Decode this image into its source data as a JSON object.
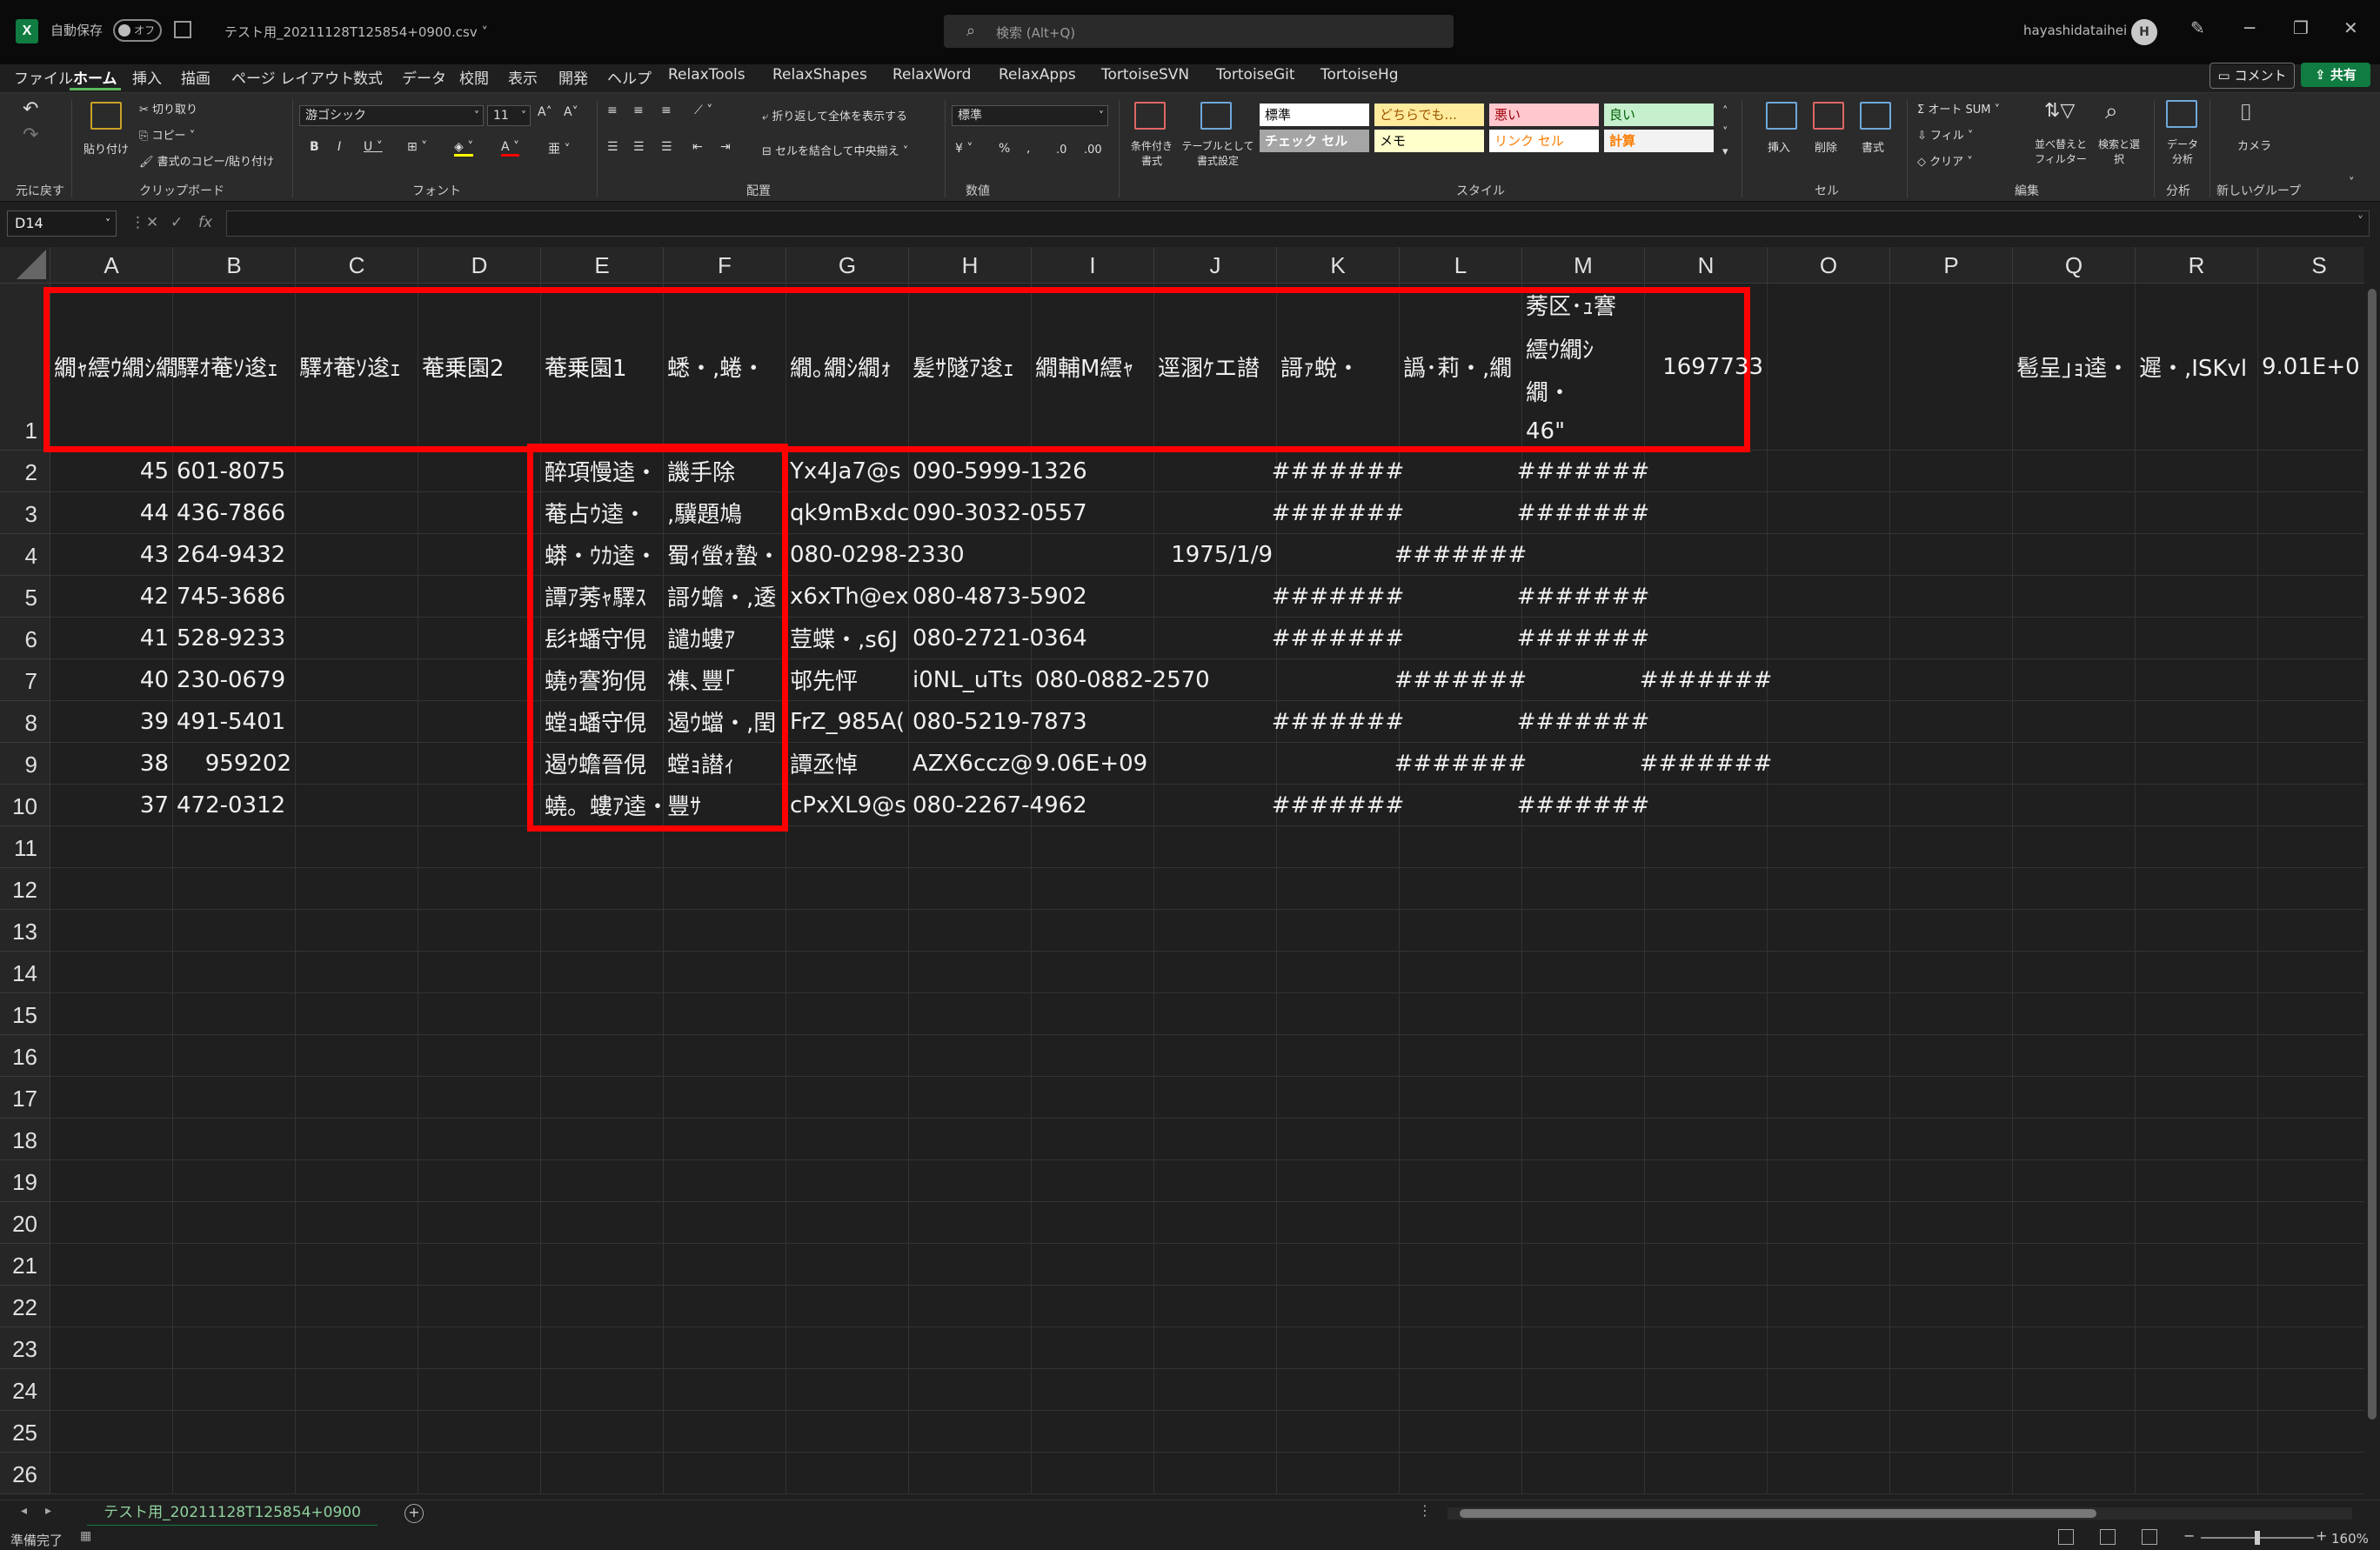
{
  "titlebar": {
    "autosave_label": "自動保存",
    "autosave_state": "オフ",
    "filename": "テスト用_20211128T125854+0900.csv ˅",
    "search_placeholder": "検索 (Alt+Q)",
    "user_name": "hayashidataihei",
    "avatar_initial": "H"
  },
  "tabs": [
    "ファイル",
    "ホーム",
    "挿入",
    "描画",
    "ページ レイアウト",
    "数式",
    "データ",
    "校閲",
    "表示",
    "開発",
    "ヘルプ",
    "RelaxTools",
    "RelaxShapes",
    "RelaxWord",
    "RelaxApps",
    "TortoiseSVN",
    "TortoiseGit",
    "TortoiseHg"
  ],
  "active_tab": "ホーム",
  "comment_button": "コメント",
  "share_button": "共有",
  "ribbon": {
    "undo_label": "元に戻す",
    "clipboard": {
      "paste": "貼り付け",
      "cut": "切り取り",
      "copy": "コピー",
      "format_painter": "書式のコピー/貼り付け",
      "label": "クリップボード"
    },
    "font": {
      "name": "游ゴシック",
      "size": "11",
      "label": "フォント"
    },
    "alignment": {
      "wrap": "折り返して全体を表示する",
      "merge": "セルを結合して中央揃え",
      "label": "配置"
    },
    "number": {
      "format": "標準",
      "label": "数値"
    },
    "styles": {
      "conditional": "条件付き書式",
      "table": "テーブルとして書式設定",
      "label": "スタイル",
      "cells": [
        {
          "text": "標準",
          "bg": "#ffffff",
          "fg": "#000000"
        },
        {
          "text": "どちらでも...",
          "bg": "#ffeb9c",
          "fg": "#9c5700"
        },
        {
          "text": "悪い",
          "bg": "#ffc7ce",
          "fg": "#9c0006"
        },
        {
          "text": "良い",
          "bg": "#c6efce",
          "fg": "#006100"
        },
        {
          "text": "チェック セル",
          "bg": "#a5a5a5",
          "fg": "#ffffff"
        },
        {
          "text": "メモ",
          "bg": "#ffffcc",
          "fg": "#000000"
        },
        {
          "text": "リンク セル",
          "bg": "#ffffff",
          "fg": "#fa7d00"
        },
        {
          "text": "計算",
          "bg": "#f2f2f2",
          "fg": "#fa7d00"
        }
      ]
    },
    "cells_group": {
      "insert": "挿入",
      "delete": "削除",
      "format": "書式",
      "label": "セル"
    },
    "editing": {
      "autosum": "オート SUM",
      "fill": "フィル",
      "clear": "クリア",
      "sort": "並べ替えとフィルター",
      "find": "検索と選択",
      "label": "編集"
    },
    "analysis": {
      "data_analysis": "データ分析",
      "label": "分析"
    },
    "camera": {
      "label": "カメラ",
      "group": "新しいグループ"
    }
  },
  "formula_bar": {
    "name_box": "D14",
    "fx": "fx",
    "value": ""
  },
  "columns": [
    "A",
    "B",
    "C",
    "D",
    "E",
    "F",
    "G",
    "H",
    "I",
    "J",
    "K",
    "L",
    "M",
    "N",
    "O",
    "P",
    "Q",
    "R",
    "S"
  ],
  "rows": [
    "1",
    "2",
    "3",
    "4",
    "5",
    "6",
    "7",
    "8",
    "9",
    "10",
    "11",
    "12",
    "13",
    "14",
    "15",
    "16",
    "17",
    "18",
    "19",
    "20",
    "21",
    "22",
    "23",
    "24",
    "25",
    "26"
  ],
  "row1": {
    "A": "繝ｬ繧ｳ繝ｼ繝",
    "B": "驛ｵ菴ｿ逡ｪ",
    "C": "驛ｵ菴ｿ逡ｪ",
    "D": "菴乗園2",
    "E": "菴乗園1",
    "F": "蟋・,蜷・",
    "G": "繝｡繝ｼ繝ｫ",
    "H": "髪ｻ隧ｱ逡ｪ",
    "I": "繝輔Μ繧ｬ",
    "J": "逕溷ｹエ譛",
    "K": "謌ｧ蛻・",
    "L": "譌･莉・,繝",
    "M1": "莠区･ｭ謇",
    "M2": "繧ｳ繝ｼ",
    "M3": "繝・",
    "M4": "46\"",
    "N": "1697733",
    "Q": "髱呈｣ｮ逵・",
    "R": "遲・,ISKvl",
    "S": "9.01E+0"
  },
  "data_rows": [
    {
      "A": "45",
      "B": "601-8075",
      "E": "醉項慢逵・",
      "F": "譏手除",
      "G": "Yx4Ja7@s",
      "H": "090-5999-1326",
      "K": "#######",
      "M": "#######"
    },
    {
      "A": "44",
      "B": "436-7866",
      "E": "菴占ｳ逵・",
      "F": ",驥題鳩",
      "G": "qk9mBxdc",
      "H": "090-3032-0557",
      "K": "#######",
      "M": "#######"
    },
    {
      "A": "43",
      "B": "264-9432",
      "E": "蟒・ｳｶ逵・",
      "F": "蜀ｨ螢ｫ蟄・",
      "G": "080-0298-2330",
      "J": "1975/1/9",
      "L": "#######"
    },
    {
      "A": "42",
      "B": "745-3686",
      "E": "譚ｱ莠ｬ驛ｽ",
      "F": "謌ｸ蟾・,逶",
      "G": "x6xTh@ex",
      "H": "080-4873-5902",
      "K": "#######",
      "M": "#######"
    },
    {
      "A": "41",
      "B": "528-9233",
      "E": "髟ｷ蟠守俔",
      "F": "譴ｶ螻ｱ",
      "G": "荳蝶・,s6J",
      "H": "080-2721-0364",
      "K": "#######",
      "M": "#######"
    },
    {
      "A": "40",
      "B": "230-0679",
      "E": "蟯ｩ謇狗俔",
      "F": "襍､豐｢",
      "G": "邨先怦",
      "H": "i0NL_uTts",
      "I": "080-0882-2570",
      "L": "#######",
      "N": "#######"
    },
    {
      "A": "39",
      "B": "491-5401",
      "E": "螳ｮ蟠守俔",
      "F": "遏ｳ蟷・,閏",
      "G": "FrZ_985A(",
      "H": "080-5219-7873",
      "K": "#######",
      "M": "#######"
    },
    {
      "A": "38",
      "B": "959202",
      "E": "遏ｳ蟾晉俔",
      "F": "螳ｮ譛ｨ",
      "G": "譚丞悼",
      "H": "AZX6ccz@",
      "I": "9.06E+09",
      "L": "#######",
      "N": "#######"
    },
    {
      "A": "37",
      "B": "472-0312",
      "E": "蟯。螻ｱ逵・",
      "F": "豐ｻ",
      "G": "cPxXL9@s",
      "H": "080-2267-4962",
      "K": "#######",
      "M": "#######"
    }
  ],
  "sheet_tab": "テスト用_20211128T125854+0900",
  "status": {
    "ready": "準備完了",
    "zoom": "160%"
  },
  "colors": {
    "highlight": "#ff0000",
    "accent": "#107c41"
  }
}
